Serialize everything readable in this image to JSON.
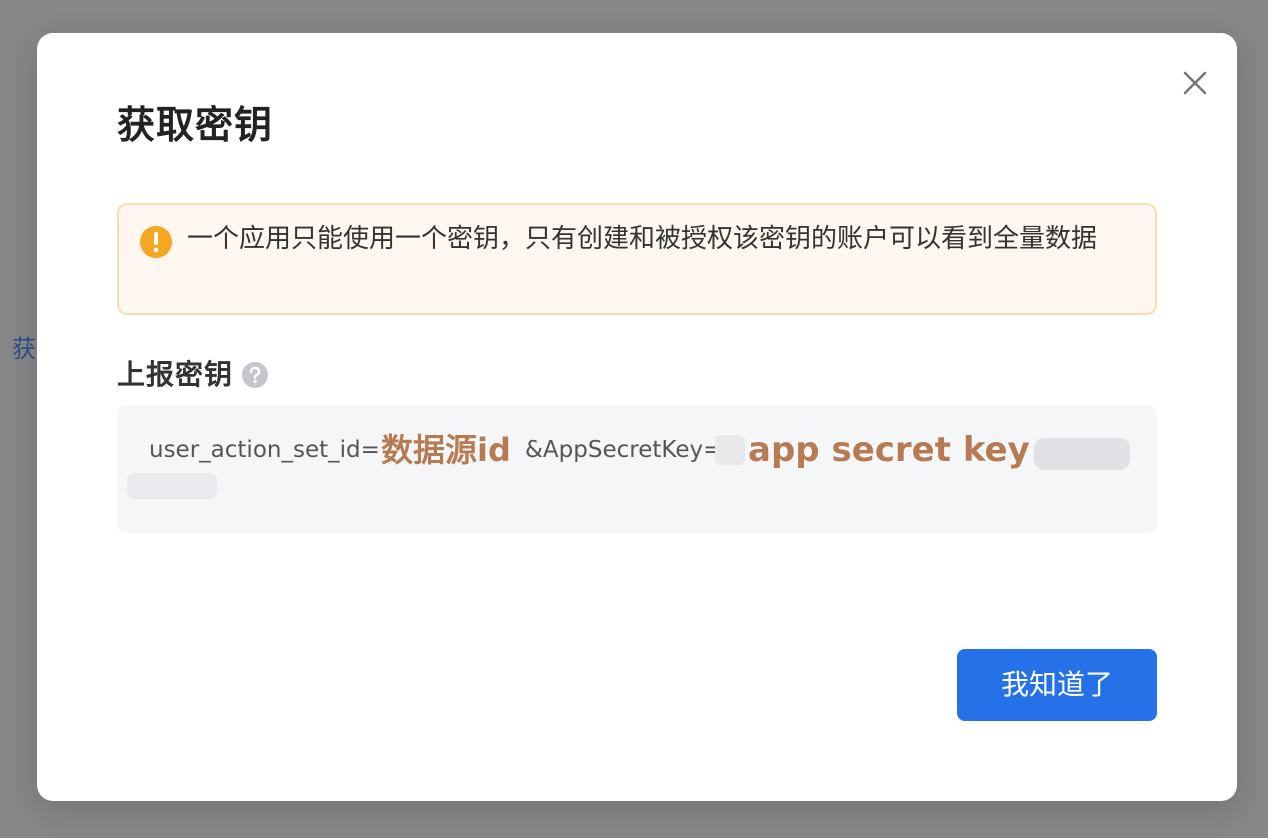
{
  "background": {
    "partial_text": "获"
  },
  "modal": {
    "title": "获取密钥",
    "alert": {
      "icon": "warning-icon",
      "text": "一个应用只能使用一个密钥，只有创建和被授权该密钥的账户可以看到全量数据"
    },
    "key_section": {
      "label": "上报密钥",
      "help_icon": "question-mark-icon",
      "key_prefix": "user_action_set_id=",
      "source_id_placeholder": "数据源id",
      "key_mid": "&AppSecretKey=",
      "secret_placeholder": "app secret key"
    },
    "confirm_button": "我知道了",
    "close_icon": "close-icon"
  },
  "colors": {
    "overlay": "#878787",
    "primary_button": "#2572e8",
    "alert_background": "#fef7f0",
    "alert_border": "#f9ddb0",
    "warning_icon": "#f5a623",
    "annotation_text": "#b87a53"
  }
}
